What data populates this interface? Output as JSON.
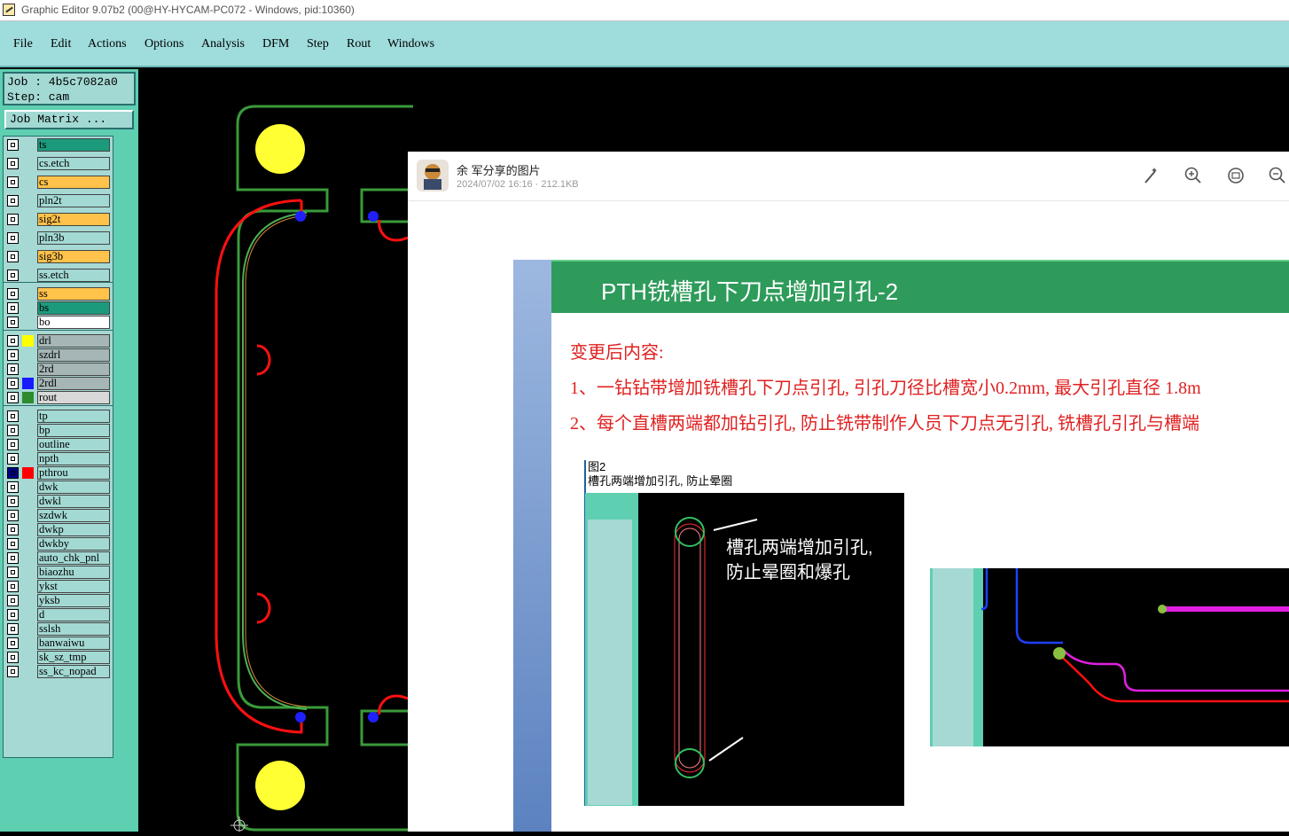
{
  "window": {
    "title": "Graphic Editor 9.07b2 (00@HY-HYCAM-PC072 - Windows, pid:10360)"
  },
  "menu": [
    "File",
    "Edit",
    "Actions",
    "Options",
    "Analysis",
    "DFM",
    "Step",
    "Rout",
    "Windows"
  ],
  "job": {
    "job_line": "Job : 4b5c7082a0",
    "step_line": "Step: cam",
    "matrix_button": "Job Matrix ..."
  },
  "layers": [
    {
      "name": "ts",
      "color": "#1c9a7c"
    },
    {
      "name": "cs.etch",
      "color": "#a3d9d3"
    },
    {
      "name": "cs",
      "color": "#ffc24a"
    },
    {
      "name": "pln2t",
      "color": "#a3d9d3"
    },
    {
      "name": "sig2t",
      "color": "#ffc24a"
    },
    {
      "name": "pln3b",
      "color": "#a3d9d3"
    },
    {
      "name": "sig3b",
      "color": "#ffc24a"
    },
    {
      "name": "ss.etch",
      "color": "#a3d9d3"
    },
    {
      "name": "ss",
      "color": "#ffc24a"
    },
    {
      "name": "bs",
      "color": "#1c9a7c"
    },
    {
      "name": "bo",
      "color": "#ffffff"
    },
    {
      "name": "drl",
      "color": "#a6b6b6"
    },
    {
      "name": "szdrl",
      "color": "#a6b6b6"
    },
    {
      "name": "2rd",
      "color": "#a6b6b6"
    },
    {
      "name": "2rdl",
      "color": "#a6b6b6"
    },
    {
      "name": "rout",
      "color": "#d8d8d8"
    },
    {
      "name": "tp",
      "color": "#a3d9d3"
    },
    {
      "name": "bp",
      "color": "#a3d9d3"
    },
    {
      "name": "outline",
      "color": "#a3d9d3"
    },
    {
      "name": "npth",
      "color": "#a3d9d3"
    },
    {
      "name": "pthrou",
      "color": "#a3d9d3"
    },
    {
      "name": "dwk",
      "color": "#a3d9d3"
    },
    {
      "name": "dwkl",
      "color": "#a3d9d3"
    },
    {
      "name": "szdwk",
      "color": "#a3d9d3"
    },
    {
      "name": "dwkp",
      "color": "#a3d9d3"
    },
    {
      "name": "dwkby",
      "color": "#a3d9d3"
    },
    {
      "name": "auto_chk_pnl",
      "color": "#a3d9d3"
    },
    {
      "name": "biaozhu",
      "color": "#a3d9d3"
    },
    {
      "name": "ykst",
      "color": "#a3d9d3"
    },
    {
      "name": "yksb",
      "color": "#a3d9d3"
    },
    {
      "name": "d",
      "color": "#a3d9d3"
    },
    {
      "name": "sslsh",
      "color": "#a3d9d3"
    },
    {
      "name": "banwaiwu",
      "color": "#a3d9d3"
    },
    {
      "name": "sk_sz_tmp",
      "color": "#a3d9d3"
    },
    {
      "name": "ss_kc_nopad",
      "color": "#a3d9d3"
    }
  ],
  "viewer": {
    "title": "余 军分享的图片",
    "meta": "2024/07/02 16:16 · 212.1KB",
    "tools": [
      "magic-wand-icon",
      "zoom-in-icon",
      "fit-icon",
      "zoom-out-icon"
    ]
  },
  "slide": {
    "title": "PTH铣槽孔下刀点增加引孔-2",
    "heading": "变更后内容:",
    "line1": "1、一钻钻带增加铣槽孔下刀点引孔, 引孔刀径比槽宽小0.2mm, 最大引孔直径 1.8m",
    "line2": "2、每个直槽两端都加钻引孔, 防止铣带制作人员下刀点无引孔, 铣槽孔引孔与槽端",
    "fig_label": "图2",
    "fig_caption": "槽孔两端增加引孔, 防止晕圈",
    "inner_caption_1": "槽孔两端增加引孔,",
    "inner_caption_2": "防止晕圈和爆孔"
  }
}
